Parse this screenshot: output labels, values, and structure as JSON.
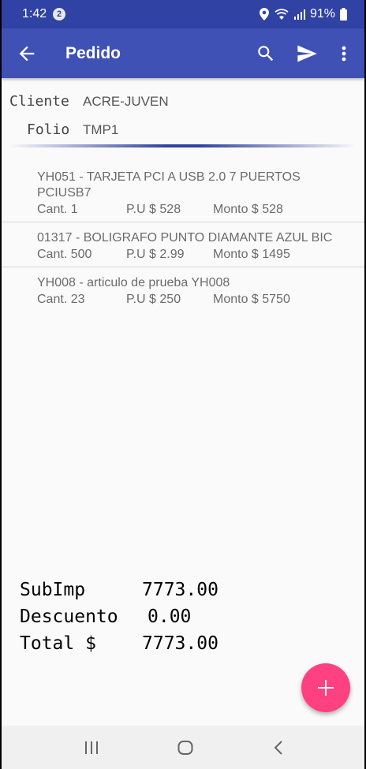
{
  "status_bar": {
    "time": "1:42",
    "notification_count": "2",
    "battery": "91%",
    "icons": [
      "location-icon",
      "wifi-icon",
      "signal-icon",
      "battery-icon"
    ]
  },
  "app_bar": {
    "title": "Pedido",
    "icons": [
      "back-arrow-icon",
      "search-icon",
      "send-icon",
      "more-vert-icon"
    ],
    "color": "#3f51b5"
  },
  "header": {
    "cliente_label": "Cliente",
    "cliente_value": "ACRE-JUVEN",
    "folio_label": "Folio",
    "folio_value": "TMP1"
  },
  "items": [
    {
      "description": "YH051 - TARJETA PCI A USB 2.0 7 PUERTOS PCIUSB7",
      "qty": "Cant. 1",
      "pu": "P.U $ 528",
      "monto": "Monto $ 528"
    },
    {
      "description": "01317 - BOLIGRAFO PUNTO DIAMANTE AZUL BIC",
      "qty": "Cant. 500",
      "pu": "P.U $ 2.99",
      "monto": "Monto $ 1495"
    },
    {
      "description": "YH008 - articulo de prueba YH008",
      "qty": "Cant. 23",
      "pu": "P.U $ 250",
      "monto": "Monto $ 5750"
    }
  ],
  "totals": {
    "subimp_label": "SubImp",
    "subimp_value": "7773.00",
    "descuento_label": "Descuento",
    "descuento_value": "0.00",
    "total_label": "Total $",
    "total_value": "7773.00"
  },
  "fab": {
    "icon": "plus-icon",
    "color": "#ff4081"
  },
  "nav_bar": {
    "icons": [
      "recent-apps-icon",
      "home-icon",
      "back-nav-icon"
    ]
  }
}
